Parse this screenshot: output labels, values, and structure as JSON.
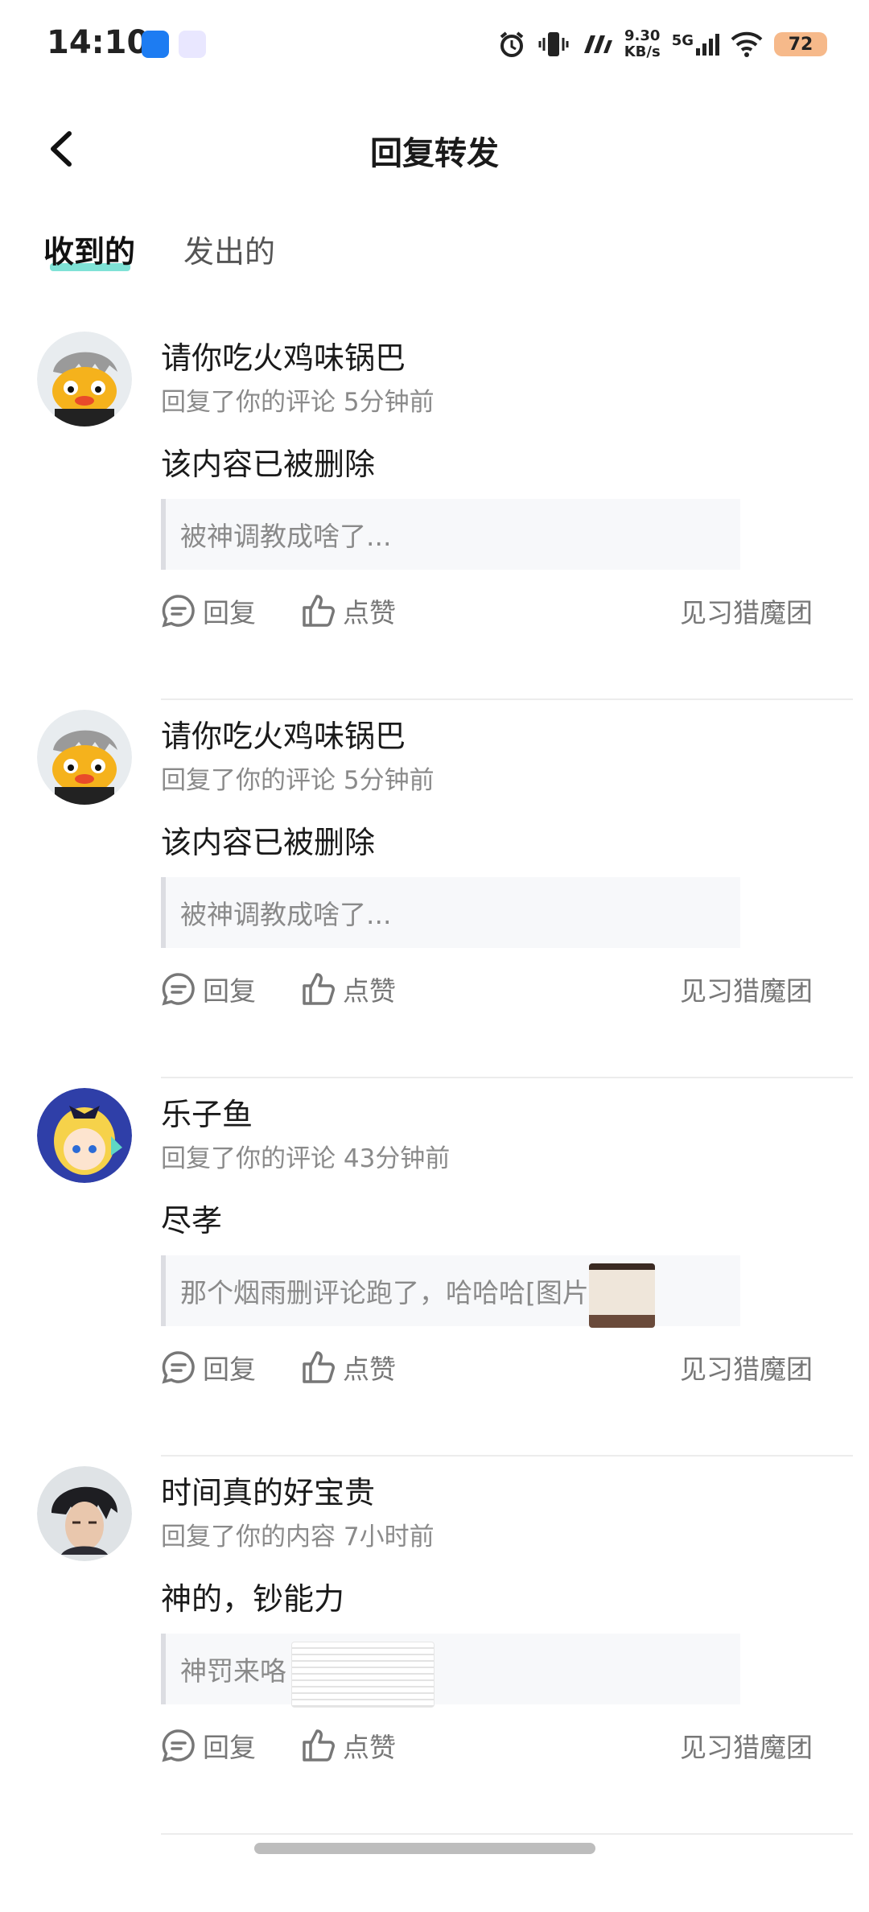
{
  "status_bar": {
    "time": "14:10",
    "speed_value": "9.30",
    "speed_unit": "KB/s",
    "network": "5G",
    "battery": "72"
  },
  "header": {
    "title": "回复转发"
  },
  "tabs": [
    {
      "label": "收到的"
    },
    {
      "label": "发出的"
    }
  ],
  "items": [
    {
      "name": "请你吃火鸡味锅巴",
      "meta": "回复了你的评论 5分钟前",
      "content": "该内容已被删除",
      "quote": "被神调教成啥了...",
      "actions": {
        "reply": "回复",
        "like": "点赞",
        "group": "见习猎魔团"
      }
    },
    {
      "name": "请你吃火鸡味锅巴",
      "meta": "回复了你的评论 5分钟前",
      "content": "该内容已被删除",
      "quote": "被神调教成啥了...",
      "actions": {
        "reply": "回复",
        "like": "点赞",
        "group": "见习猎魔团"
      }
    },
    {
      "name": "乐子鱼",
      "meta": "回复了你的评论 43分钟前",
      "content": "尽孝",
      "quote": "那个烟雨删评论跑了，哈哈哈[图片]",
      "actions": {
        "reply": "回复",
        "like": "点赞",
        "group": "见习猎魔团"
      }
    },
    {
      "name": "时间真的好宝贵",
      "meta": "回复了你的内容 7小时前",
      "content": "神的，钞能力",
      "quote": "神罚来咯",
      "actions": {
        "reply": "回复",
        "like": "点赞",
        "group": "见习猎魔团"
      }
    }
  ]
}
